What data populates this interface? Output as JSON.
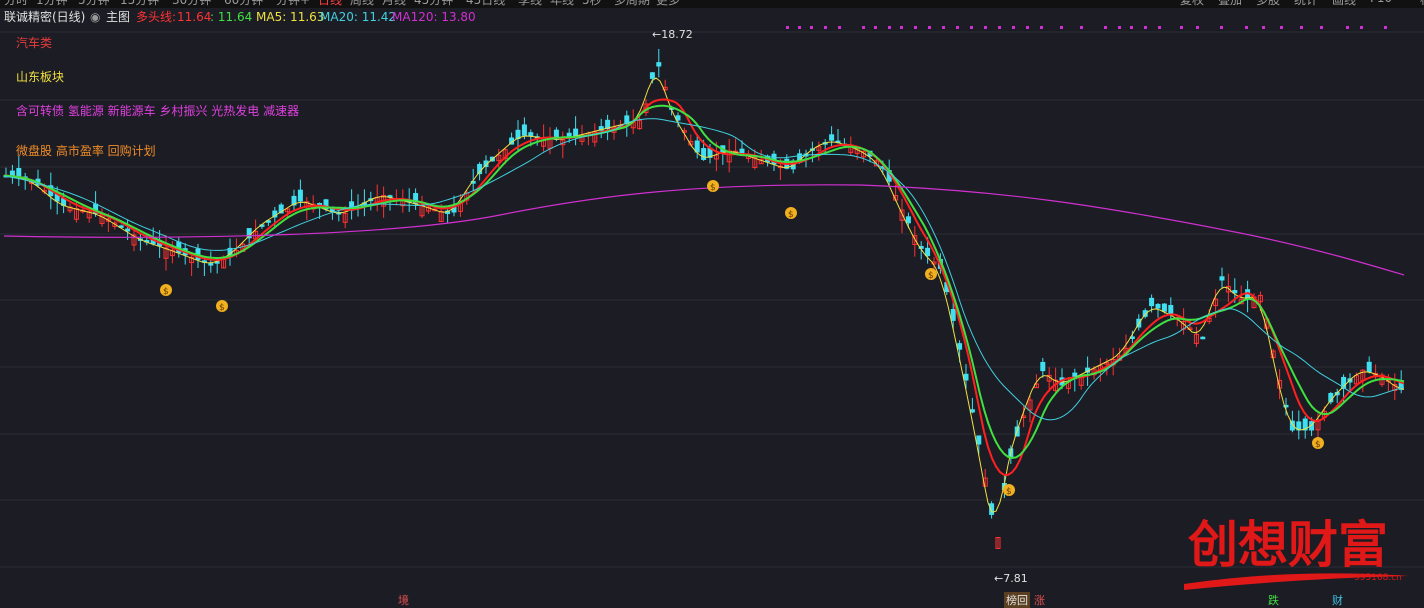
{
  "top_menu": [
    "分时",
    "1分钟",
    "5分钟",
    "15分钟",
    "30分钟",
    "60分钟",
    "分钟+",
    "日线",
    "周线",
    "月线",
    "45分钟",
    "45日线",
    "季线",
    "年线",
    "5秒",
    "多周期",
    "更多"
  ],
  "top_right": [
    "复权",
    "叠加",
    "多股",
    "统计",
    "画线",
    "F10",
    "标记"
  ],
  "header": {
    "stock": "联诚精密(日线)",
    "main_label": "主图",
    "indicator_name": "多头线:",
    "indicator_val": "11.64",
    "ma_short": ": 11.64",
    "ma5": "MA5: 11.63",
    "ma20": "MA20: 11.42",
    "ma120": "MA120: 13.80"
  },
  "tags": [
    {
      "text": "汽车类",
      "color": "#e83c3c"
    },
    {
      "text": "山东板块",
      "color": "#f0e040"
    },
    {
      "text": "含可转债 氢能源 新能源车 乡村振兴 光热发电 减速器",
      "color": "#e040e0"
    },
    {
      "text": "微盘股 高市盈率 回购计划",
      "color": "#f08c28"
    }
  ],
  "labels": {
    "high": "18.72",
    "low": "7.81"
  },
  "bottom_marks": [
    "境",
    "榜回",
    "涨",
    "跌",
    "财"
  ],
  "watermark": {
    "title": "创想财富",
    "url": "995168.cn"
  },
  "colors": {
    "up": "#ff3232",
    "down": "#40e0f0",
    "ma5": "#f0e040",
    "ma10": "#40e040",
    "ma_red": "#ff2020",
    "ma20": "#40d0e0",
    "ma120": "#d030d0",
    "bg": "#1c1c24"
  }
}
